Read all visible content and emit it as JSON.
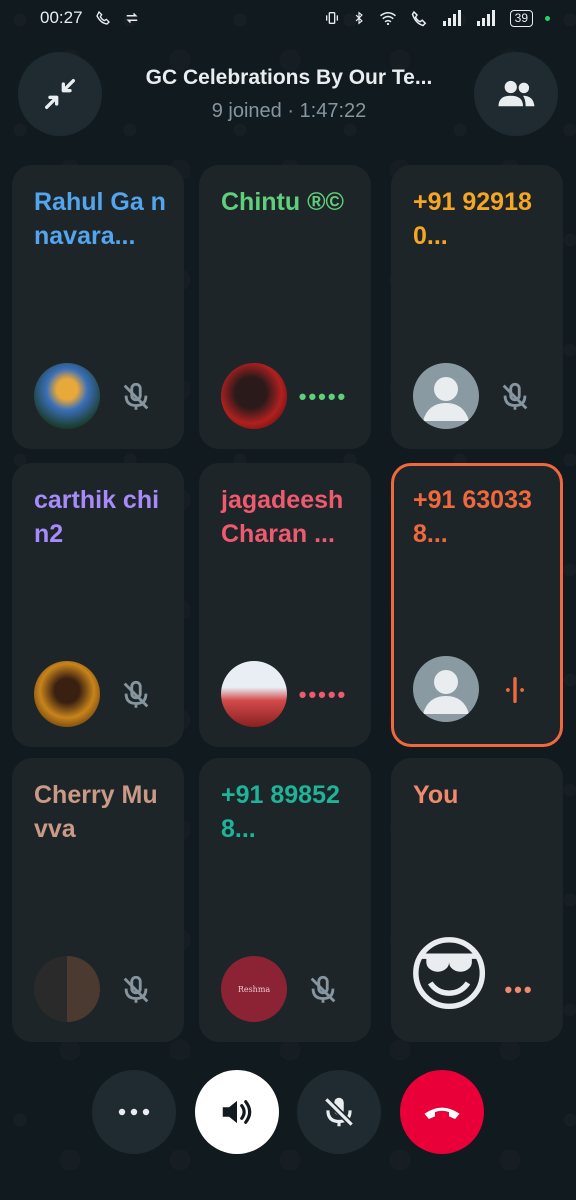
{
  "status_bar": {
    "time": "00:27",
    "battery": "39"
  },
  "header": {
    "title": "GC Celebrations By Our Te...",
    "subtitle": "9 joined · 1:47:22"
  },
  "participants": [
    {
      "name": "Rahul Ga nnavara...",
      "color": "#53a5ee",
      "avatar": "photo-avatar",
      "indicator": "mic-off-icon"
    },
    {
      "name": "Chintu ®©",
      "color": "#5fcf7a",
      "avatar": "photo-avatar",
      "indicator": "dots-green"
    },
    {
      "name": "+91 92918 0...",
      "color": "#f5a623",
      "avatar": "default-avatar",
      "indicator": "mic-off-icon"
    },
    {
      "name": "carthik chin2",
      "color": "#a78bfa",
      "avatar": "photo-avatar",
      "indicator": "mic-off-icon"
    },
    {
      "name": "jagadeesh Charan ...",
      "color": "#ef5a6f",
      "avatar": "photo-avatar",
      "indicator": "dots-red"
    },
    {
      "name": "+91 63033 8...",
      "color": "#f0693e",
      "avatar": "default-avatar",
      "indicator": "speaking-icon",
      "speaking": true
    },
    {
      "name": "Cherry Muvva",
      "color": "#c99a87",
      "avatar": "photo-avatar",
      "indicator": "mic-off-icon"
    },
    {
      "name": "+91 89852 8...",
      "color": "#1fb39a",
      "avatar": "initial-avatar",
      "avatar_text": "Reshma",
      "indicator": "mic-off-icon"
    },
    {
      "name": "You",
      "color": "#f08a6c",
      "avatar": "emoji-avatar",
      "avatar_text": "😎",
      "indicator": "dots-orange"
    }
  ],
  "colors": {
    "accent_speaking": "#f0693e",
    "end_call": "#ea0038",
    "tile_bg": "#1e2528"
  }
}
